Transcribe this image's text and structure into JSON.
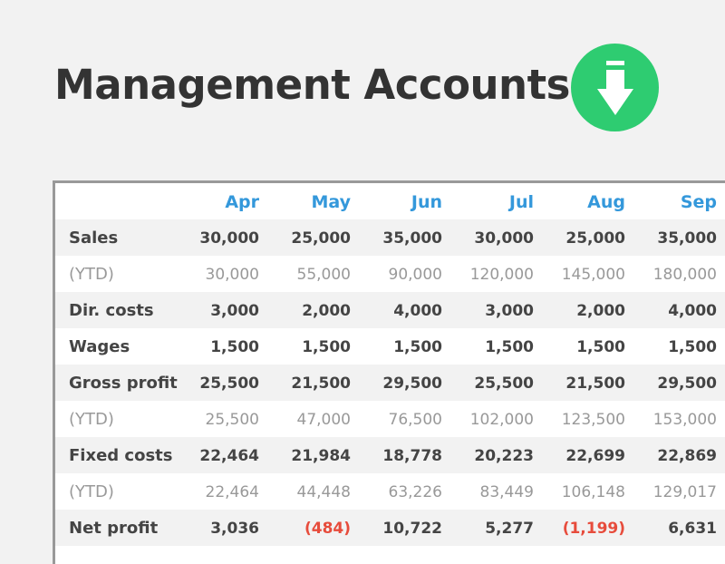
{
  "title": "Management Accounts",
  "download_icon": "download-arrow-icon",
  "colors": {
    "accent": "#3498db",
    "download": "#2ecc71",
    "negative": "#e74c3c"
  },
  "table": {
    "months": [
      "Apr",
      "May",
      "Jun",
      "Jul",
      "Aug",
      "Sep"
    ],
    "rows": [
      {
        "label": "Sales",
        "type": "main",
        "values": [
          "30,000",
          "25,000",
          "35,000",
          "30,000",
          "25,000",
          "35,000"
        ]
      },
      {
        "label": "(YTD)",
        "type": "ytd",
        "values": [
          "30,000",
          "55,000",
          "90,000",
          "120,000",
          "145,000",
          "180,000"
        ]
      },
      {
        "label": "Dir. costs",
        "type": "main",
        "values": [
          "3,000",
          "2,000",
          "4,000",
          "3,000",
          "2,000",
          "4,000"
        ]
      },
      {
        "label": "Wages",
        "type": "main",
        "values": [
          "1,500",
          "1,500",
          "1,500",
          "1,500",
          "1,500",
          "1,500"
        ]
      },
      {
        "label": "Gross profit",
        "type": "main",
        "values": [
          "25,500",
          "21,500",
          "29,500",
          "25,500",
          "21,500",
          "29,500"
        ]
      },
      {
        "label": "(YTD)",
        "type": "ytd",
        "values": [
          "25,500",
          "47,000",
          "76,500",
          "102,000",
          "123,500",
          "153,000"
        ]
      },
      {
        "label": "Fixed costs",
        "type": "main",
        "values": [
          "22,464",
          "21,984",
          "18,778",
          "20,223",
          "22,699",
          "22,869"
        ]
      },
      {
        "label": "(YTD)",
        "type": "ytd",
        "values": [
          "22,464",
          "44,448",
          "63,226",
          "83,449",
          "106,148",
          "129,017"
        ]
      },
      {
        "label": "Net profit",
        "type": "main",
        "values": [
          "3,036",
          "(484)",
          "10,722",
          "5,277",
          "(1,199)",
          "6,631"
        ]
      }
    ]
  }
}
